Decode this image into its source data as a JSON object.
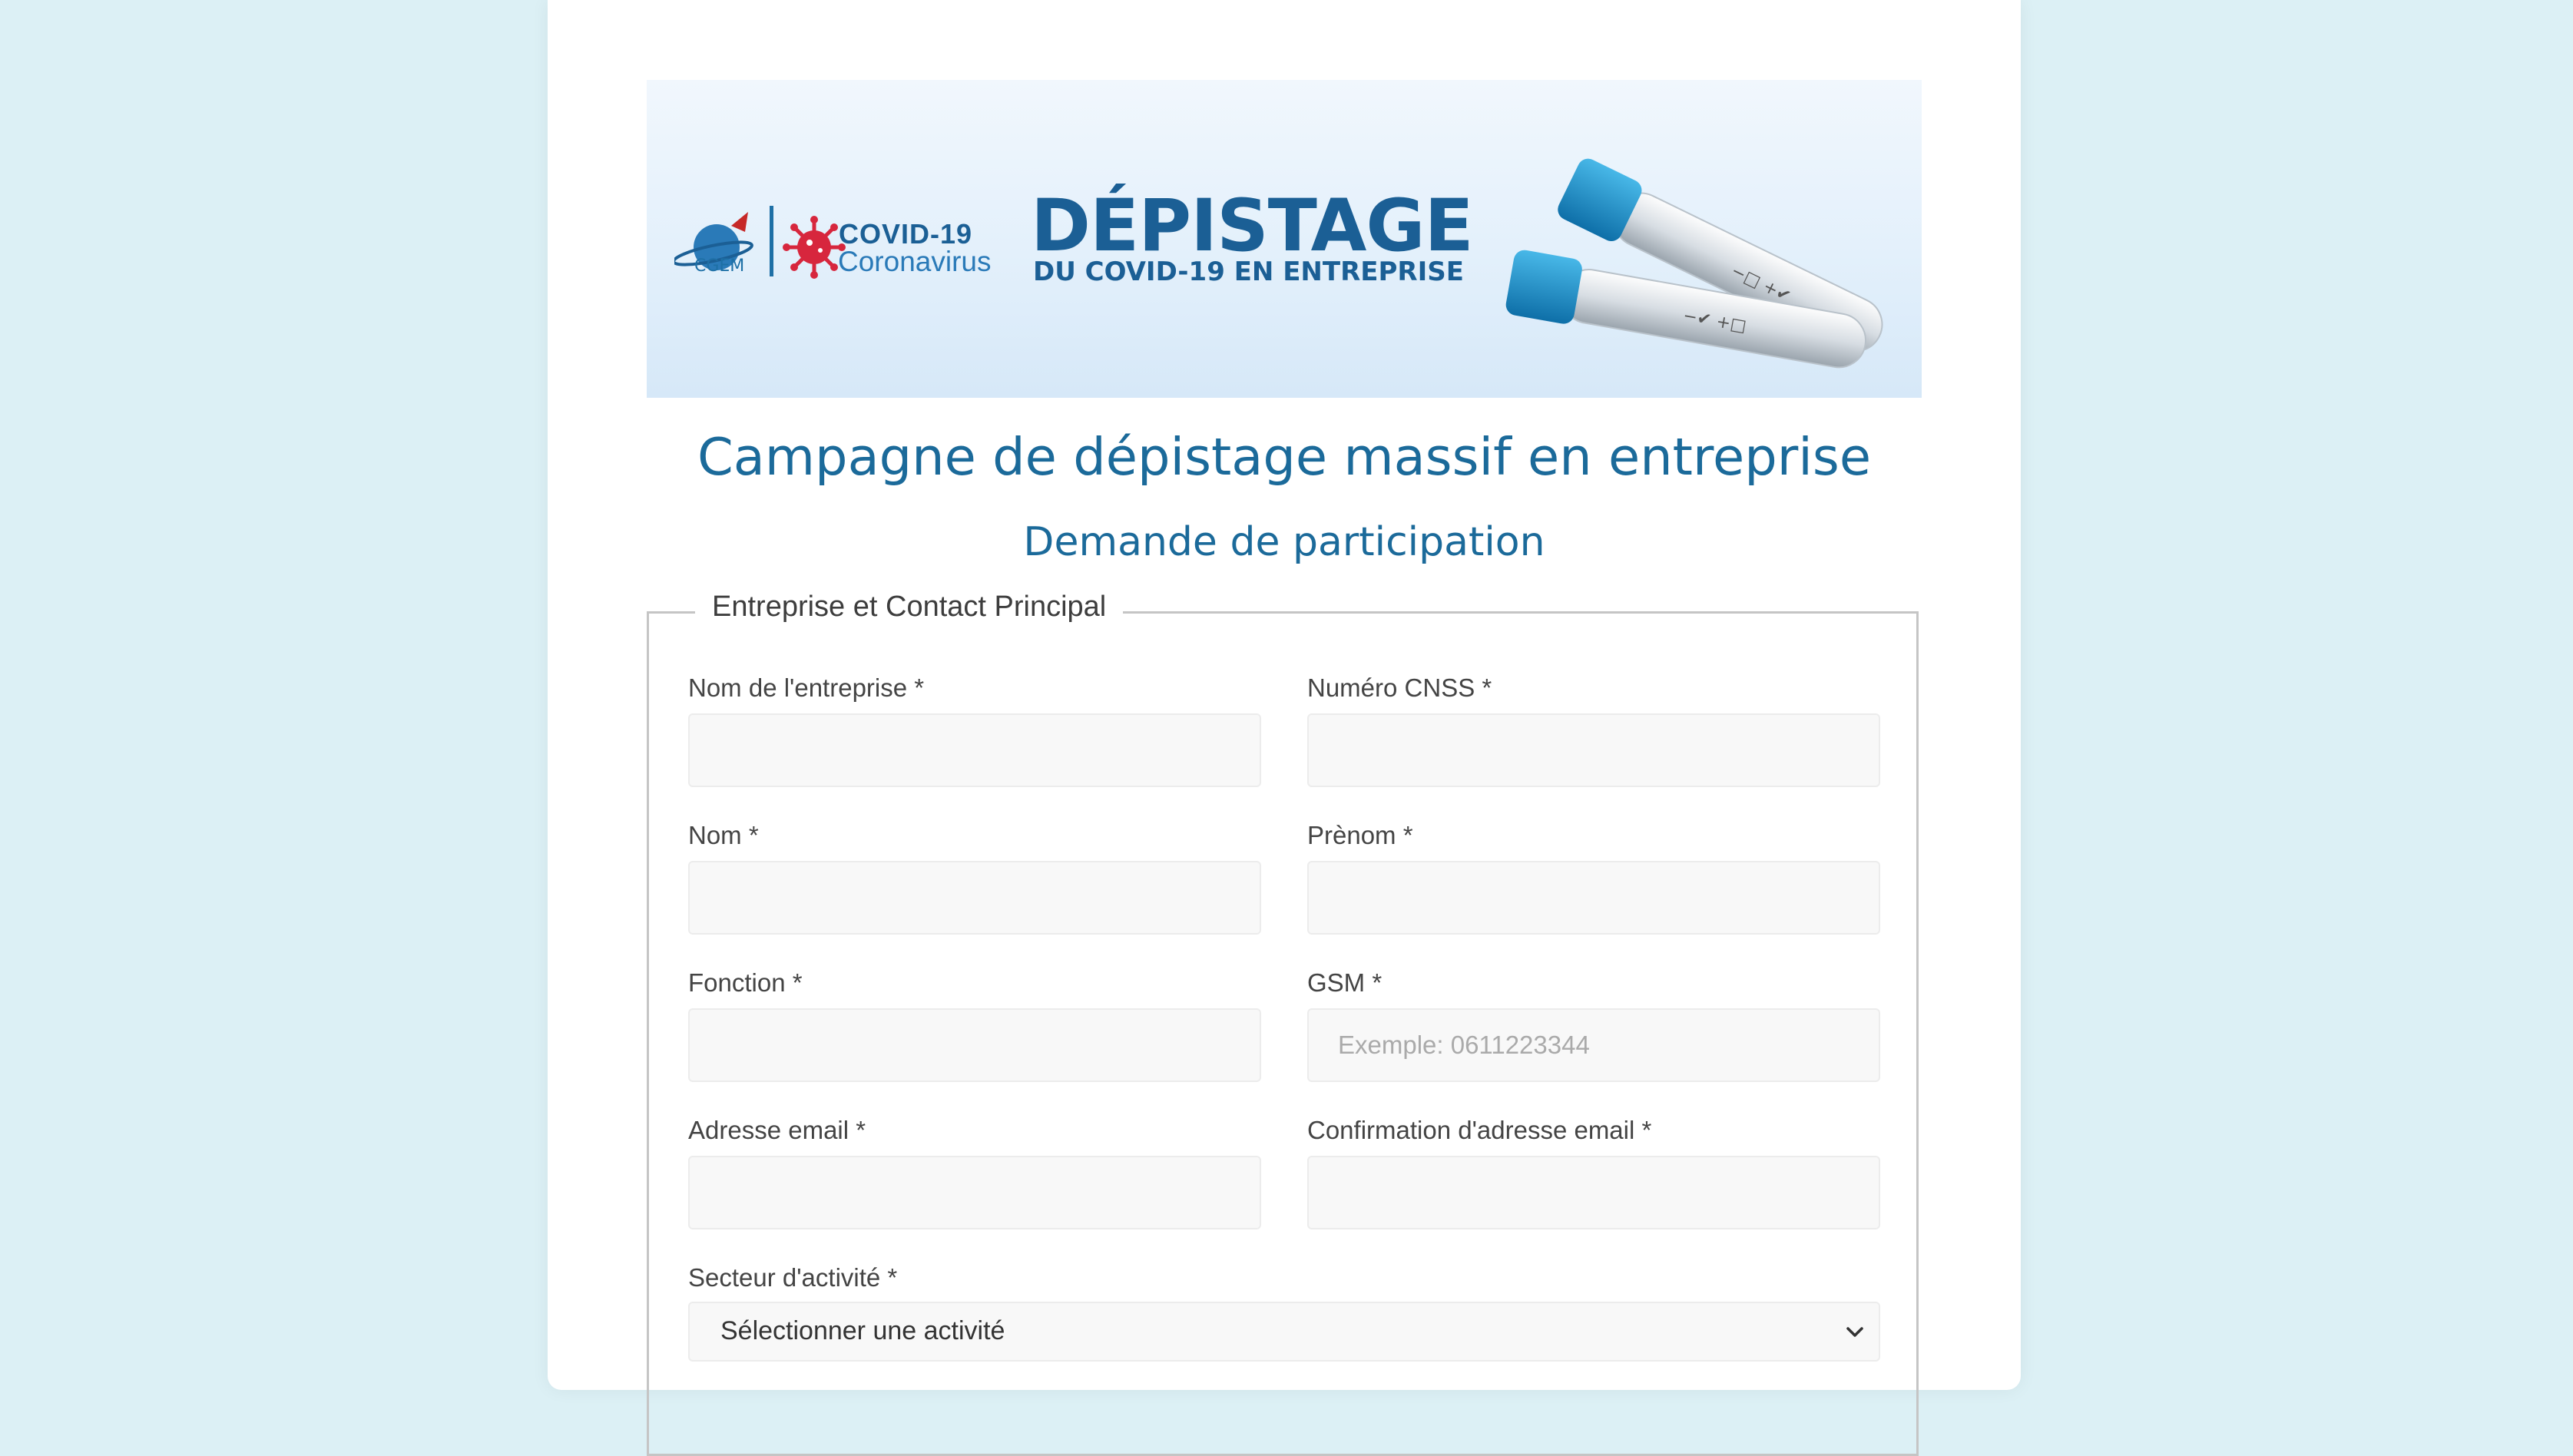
{
  "banner": {
    "cgem_label": "CGEM",
    "covid_title": "COVID-19",
    "covid_subtitle": "Coronavirus",
    "title": "DÉPISTAGE",
    "subtitle": "DU COVID-19 EN ENTREPRISE"
  },
  "page": {
    "title": "Campagne de dépistage massif en entreprise",
    "subtitle": "Demande de participation"
  },
  "form": {
    "legend": "Entreprise et Contact Principal",
    "company_name_label": "Nom de l'entreprise *",
    "company_name_value": "",
    "cnss_label": "Numéro CNSS *",
    "cnss_value": "",
    "last_name_label": "Nom *",
    "last_name_value": "",
    "first_name_label": "Prènom *",
    "first_name_value": "",
    "function_label": "Fonction *",
    "function_value": "",
    "gsm_label": "GSM *",
    "gsm_value": "",
    "gsm_placeholder": "Exemple: 0611223344",
    "email_label": "Adresse email *",
    "email_value": "",
    "email_confirm_label": "Confirmation d'adresse email *",
    "email_confirm_value": "",
    "sector_label": "Secteur d'activité *",
    "sector_selected": "Sélectionner une activité"
  },
  "colors": {
    "background": "#dcf0f5",
    "heading": "#1b6a9a",
    "brand_blue": "#1b5f95",
    "virus_red": "#d7263d"
  }
}
